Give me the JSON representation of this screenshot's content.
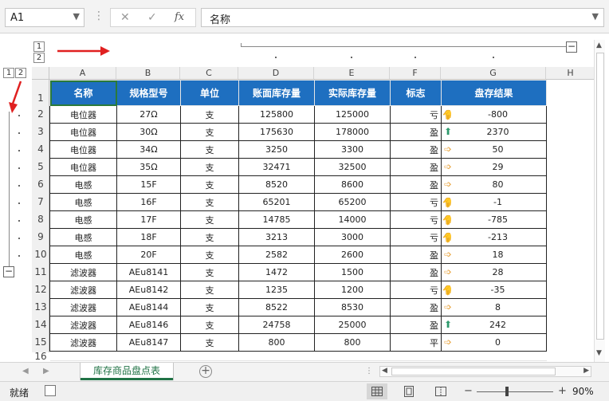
{
  "formula_bar": {
    "name_box": "A1",
    "cancel_icon": "✕",
    "enter_icon": "✓",
    "fx_label": "fx",
    "content": "名称"
  },
  "outline": {
    "col_levels": [
      "1",
      "2"
    ],
    "row_levels": [
      "1",
      "2"
    ],
    "collapse": "−"
  },
  "columns": [
    "A",
    "B",
    "C",
    "D",
    "E",
    "F",
    "G",
    "H"
  ],
  "table": {
    "headers": [
      "名称",
      "规格型号",
      "单位",
      "账面库存量",
      "实际库存量",
      "标志",
      "盘存结果"
    ],
    "rows": [
      {
        "name": "电位器",
        "spec": "27Ω",
        "unit": "支",
        "book": "125800",
        "actual": "125000",
        "flag": "亏",
        "icon": "down",
        "result": "-800"
      },
      {
        "name": "电位器",
        "spec": "30Ω",
        "unit": "支",
        "book": "175630",
        "actual": "178000",
        "flag": "盈",
        "icon": "up",
        "result": "2370"
      },
      {
        "name": "电位器",
        "spec": "34Ω",
        "unit": "支",
        "book": "3250",
        "actual": "3300",
        "flag": "盈",
        "icon": "right",
        "result": "50"
      },
      {
        "name": "电位器",
        "spec": "35Ω",
        "unit": "支",
        "book": "32471",
        "actual": "32500",
        "flag": "盈",
        "icon": "right",
        "result": "29"
      },
      {
        "name": "电感",
        "spec": "15F",
        "unit": "支",
        "book": "8520",
        "actual": "8600",
        "flag": "盈",
        "icon": "right",
        "result": "80"
      },
      {
        "name": "电感",
        "spec": "16F",
        "unit": "支",
        "book": "65201",
        "actual": "65200",
        "flag": "亏",
        "icon": "down",
        "result": "-1"
      },
      {
        "name": "电感",
        "spec": "17F",
        "unit": "支",
        "book": "14785",
        "actual": "14000",
        "flag": "亏",
        "icon": "down",
        "result": "-785"
      },
      {
        "name": "电感",
        "spec": "18F",
        "unit": "支",
        "book": "3213",
        "actual": "3000",
        "flag": "亏",
        "icon": "down",
        "result": "-213"
      },
      {
        "name": "电感",
        "spec": "20F",
        "unit": "支",
        "book": "2582",
        "actual": "2600",
        "flag": "盈",
        "icon": "right",
        "result": "18"
      },
      {
        "name": "滤波器",
        "spec": "AEu8141",
        "unit": "支",
        "book": "1472",
        "actual": "1500",
        "flag": "盈",
        "icon": "right",
        "result": "28"
      },
      {
        "name": "滤波器",
        "spec": "AEu8142",
        "unit": "支",
        "book": "1235",
        "actual": "1200",
        "flag": "亏",
        "icon": "down",
        "result": "-35"
      },
      {
        "name": "滤波器",
        "spec": "AEu8144",
        "unit": "支",
        "book": "8522",
        "actual": "8530",
        "flag": "盈",
        "icon": "right",
        "result": "8"
      },
      {
        "name": "滤波器",
        "spec": "AEu8146",
        "unit": "支",
        "book": "24758",
        "actual": "25000",
        "flag": "盈",
        "icon": "up",
        "result": "242"
      },
      {
        "name": "滤波器",
        "spec": "AEu8147",
        "unit": "支",
        "book": "800",
        "actual": "800",
        "flag": "平",
        "icon": "right",
        "result": "0"
      }
    ]
  },
  "row_numbers": [
    "1",
    "2",
    "3",
    "4",
    "5",
    "6",
    "7",
    "8",
    "9",
    "10",
    "11",
    "12",
    "13",
    "14",
    "15",
    "16"
  ],
  "sheet_tab": "库存商品盘点表",
  "add_sheet": "+",
  "status": {
    "ready": "就绪",
    "zoom_minus": "−",
    "zoom_plus": "+",
    "zoom": "90%"
  },
  "colors": {
    "header_bg": "#1e6fc0",
    "excel_green": "#217346",
    "icon_down": "#e0452b",
    "icon_up": "#2f9a6d",
    "icon_right": "#e8a23a"
  }
}
